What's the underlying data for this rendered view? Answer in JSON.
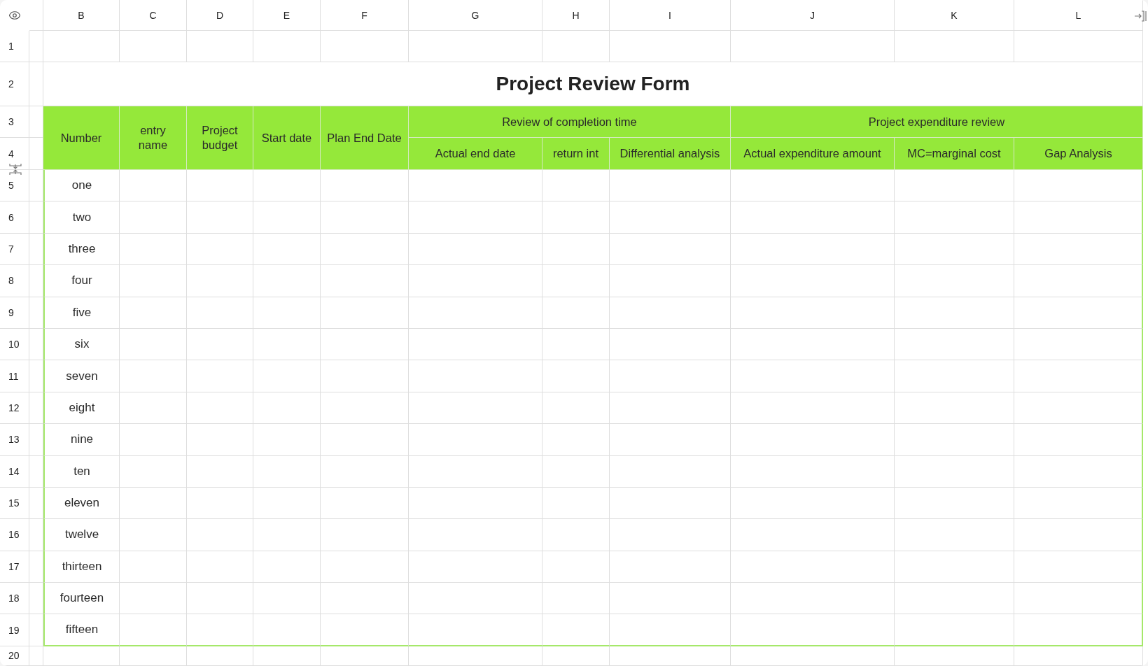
{
  "column_letters": [
    "B",
    "C",
    "D",
    "E",
    "F",
    "G",
    "H",
    "I",
    "J",
    "K",
    "L"
  ],
  "row_numbers": [
    "1",
    "2",
    "3",
    "4",
    "5",
    "6",
    "7",
    "8",
    "9",
    "10",
    "11",
    "12",
    "13",
    "14",
    "15",
    "16",
    "17",
    "18",
    "19",
    "20"
  ],
  "title": "Project Review Form",
  "header": {
    "single_columns": [
      "Number",
      "entry name",
      "Project budget",
      "Start date",
      "Plan End Date"
    ],
    "groups": [
      {
        "label": "Review of completion time",
        "columns": [
          "Actual end date",
          "return int",
          "Differential analysis"
        ]
      },
      {
        "label": "Project expenditure review",
        "columns": [
          "Actual expenditure amount",
          "MC=marginal cost",
          "Gap Analysis"
        ]
      }
    ]
  },
  "rows": [
    "one",
    "two",
    "three",
    "four",
    "five",
    "six",
    "seven",
    "eight",
    "nine",
    "ten",
    "eleven",
    "twelve",
    "thirteen",
    "fourteen",
    "fifteen"
  ]
}
